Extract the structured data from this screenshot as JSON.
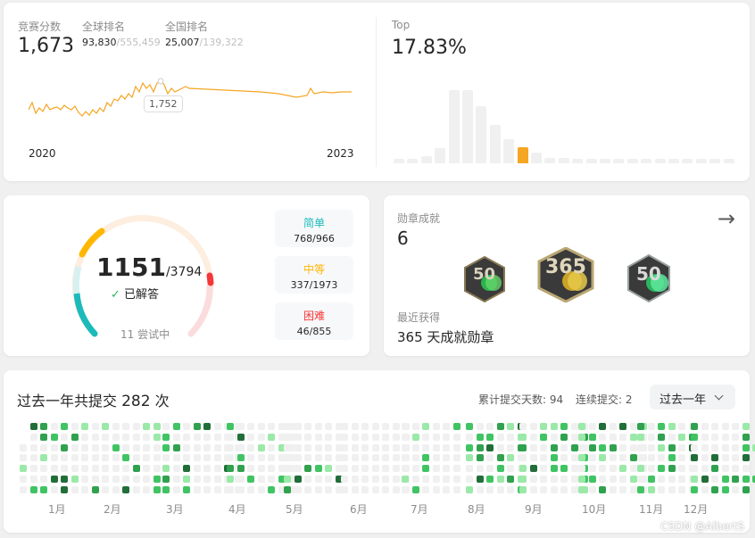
{
  "rating": {
    "contest_label": "竞赛分数",
    "contest_value": "1,673",
    "global_label": "全球排名",
    "global_rank": "93,830",
    "global_total": "/555,459",
    "national_label": "全国排名",
    "national_rank": "25,007",
    "national_total": "/139,322",
    "tooltip": "1,752",
    "x_start": "2020",
    "x_end": "2023",
    "line_color": "#f5a623"
  },
  "chart_data": [
    {
      "type": "line",
      "title": "",
      "xlabel": "",
      "ylabel": "",
      "x": [
        "2020",
        "2020",
        "2020",
        "2021",
        "2021",
        "2021",
        "2021",
        "2022",
        "2022",
        "2022",
        "2022",
        "2023",
        "2023",
        "2023"
      ],
      "series": [
        {
          "values": [
            1640,
            1650,
            1645,
            1630,
            1660,
            1700,
            1752,
            1710,
            1700,
            1690,
            1685,
            1720,
            1690,
            1695
          ]
        }
      ],
      "tick_labels": [
        "2020",
        "2023"
      ],
      "highlight": {
        "value": 1752,
        "label": "1,752"
      }
    },
    {
      "type": "bar",
      "title": "",
      "xlabel": "",
      "ylabel": "",
      "values": [
        3,
        3,
        5,
        11,
        54,
        54,
        42,
        28,
        18,
        12,
        8,
        4,
        4,
        3,
        3,
        3,
        3,
        3,
        3,
        3,
        3,
        3,
        3,
        3,
        3
      ],
      "highlight_index": 9,
      "highlight_color": "#f5a623"
    }
  ],
  "top": {
    "label": "Top",
    "value": "17.83%"
  },
  "solved": {
    "count": "1151",
    "total": "/3794",
    "check": "✓",
    "solved_label": "已解答",
    "attempting": "11 尝试中",
    "easy": {
      "label": "简单",
      "value": "768/966",
      "color": "#1cbaba"
    },
    "medium": {
      "label": "中等",
      "value": "337/1973",
      "color": "#ffb700"
    },
    "hard": {
      "label": "困难",
      "value": "46/855",
      "color": "#f63737"
    }
  },
  "badges": {
    "label": "勋章成就",
    "count": "6",
    "recent_label": "最近获得",
    "recent_name": "365 天成就勋章",
    "arrow": "→",
    "badge_texts": [
      "50",
      "365",
      "50"
    ]
  },
  "submissions": {
    "title_prefix": "过去一年共提交",
    "count": "282",
    "title_suffix": "次",
    "total_days": "累计提交天数: 94",
    "streak": "连续提交: 2",
    "range_select": "过去一年",
    "months": [
      "1月",
      "2月",
      "3月",
      "4月",
      "5月",
      "6月",
      "7月",
      "8月",
      "9月",
      "10月",
      "11月",
      "12月"
    ]
  },
  "watermark": "CSDN @AlbertS"
}
